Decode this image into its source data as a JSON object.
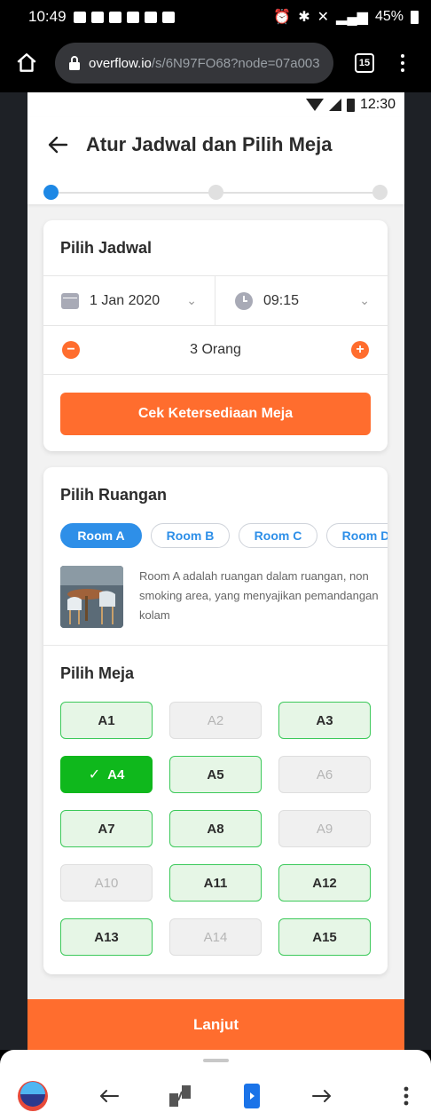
{
  "status_bar": {
    "time": "10:49",
    "battery": "45%",
    "icons_left": [
      "chat-icon",
      "youtube-icon",
      "instagram-icon",
      "instagram-icon",
      "twitter-icon",
      "gallery-icon"
    ],
    "icons_right": [
      "alarm-icon",
      "bluetooth-icon",
      "mute-icon",
      "4g-icon",
      "signal-icon",
      "battery-icon"
    ]
  },
  "browser": {
    "url_host": "overflow.io",
    "url_path": "/s/6N97FO68?node=07a003",
    "tab_count": "15"
  },
  "app": {
    "status_time": "12:30",
    "title": "Atur Jadwal dan Pilih Meja",
    "back_icon": "arrow-left-icon",
    "step_count": 3,
    "active_step": 1,
    "colors": {
      "primary": "#ff6d2e",
      "accent": "#2e8fe8",
      "available_border": "#3cc95a",
      "selected": "#0fb81c"
    }
  },
  "schedule": {
    "title": "Pilih Jadwal",
    "date": "1 Jan 2020",
    "time": "09:15",
    "people": "3 Orang",
    "decrement_icon": "minus-circle-icon",
    "increment_icon": "plus-circle-icon",
    "check_button": "Cek Ketersediaan Meja"
  },
  "room": {
    "title": "Pilih Ruangan",
    "options": [
      "Room A",
      "Room B",
      "Room C",
      "Room D"
    ],
    "selected": "Room A",
    "description": "Room A adalah ruangan dalam ruangan, non smoking area, yang menyajikan pemandangan kolam"
  },
  "tables": {
    "title": "Pilih Meja",
    "items": [
      {
        "label": "A1",
        "state": "available"
      },
      {
        "label": "A2",
        "state": "unavailable"
      },
      {
        "label": "A3",
        "state": "available"
      },
      {
        "label": "A4",
        "state": "selected"
      },
      {
        "label": "A5",
        "state": "available"
      },
      {
        "label": "A6",
        "state": "unavailable"
      },
      {
        "label": "A7",
        "state": "available"
      },
      {
        "label": "A8",
        "state": "available"
      },
      {
        "label": "A9",
        "state": "unavailable"
      },
      {
        "label": "A10",
        "state": "unavailable"
      },
      {
        "label": "A11",
        "state": "available"
      },
      {
        "label": "A12",
        "state": "available"
      },
      {
        "label": "A13",
        "state": "available"
      },
      {
        "label": "A14",
        "state": "unavailable"
      },
      {
        "label": "A15",
        "state": "available"
      }
    ]
  },
  "continue_button": "Lanjut",
  "bottom_toolbar": [
    "app-logo-icon",
    "back-arrow-icon",
    "overview-icon",
    "play-icon",
    "forward-arrow-icon",
    "more-icon"
  ]
}
